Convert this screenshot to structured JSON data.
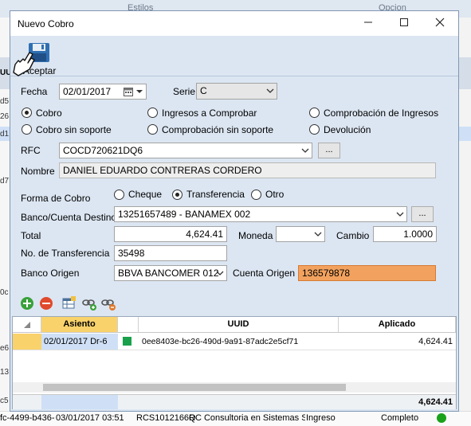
{
  "background": {
    "header_tabs": [
      "Estilos",
      "Opcion"
    ],
    "left_cells": [
      "d5",
      "26",
      "d1",
      "d7",
      "0c",
      "e6",
      "13",
      "c5"
    ],
    "left_header": "UUI",
    "bottom_row": {
      "col1": "fc-4499-b436-",
      "date": "03/01/2017 03:51",
      "rfc": "RCS1012166Q",
      "name": "RC Consultoria en Sistemas SA",
      "type": "Ingreso",
      "status": "Completo"
    }
  },
  "dialog": {
    "title": "Nuevo Cobro",
    "toolbar": {
      "accept_label": "Aceptar"
    },
    "fecha": {
      "label": "Fecha",
      "value": "02/01/2017"
    },
    "serie": {
      "label": "Serie",
      "value": "C"
    },
    "radios": {
      "cobro": "Cobro",
      "cobro_sin_soporte": "Cobro sin soporte",
      "ingresos_a_comprobar": "Ingresos a Comprobar",
      "comprobacion_sin_soporte": "Comprobación sin soporte",
      "comprobacion_de_ingresos": "Comprobación de Ingresos",
      "devolucion": "Devolución"
    },
    "rfc": {
      "label": "RFC",
      "value": "COCD720621DQ6",
      "button": "..."
    },
    "nombre": {
      "label": "Nombre",
      "value": "DANIEL EDUARDO CONTRERAS CORDERO"
    },
    "forma_cobro": {
      "label": "Forma de Cobro",
      "cheque": "Cheque",
      "transferencia": "Transferencia",
      "otro": "Otro"
    },
    "banco_destino": {
      "label": "Banco/Cuenta Destino",
      "value": "13251657489 - BANAMEX  002",
      "button": "..."
    },
    "total": {
      "label": "Total",
      "value": "4,624.41"
    },
    "moneda": {
      "label": "Moneda",
      "value": ""
    },
    "cambio": {
      "label": "Cambio",
      "value": "1.0000"
    },
    "no_transferencia": {
      "label": "No. de Transferencia",
      "value": "35498"
    },
    "banco_origen": {
      "label": "Banco Origen",
      "value": "BBVA BANCOMER  012"
    },
    "cuenta_origen": {
      "label": "Cuenta Origen",
      "value": "136579878"
    },
    "grid": {
      "headers": {
        "asiento": "Asiento",
        "uuid": "UUID",
        "aplicado": "Aplicado"
      },
      "rows": [
        {
          "asiento": "02/01/2017 Dr-6",
          "uuid": "0ee8403e-bc26-490d-9a91-87adc2e5cf71",
          "aplicado": "4,624.41"
        }
      ],
      "total": "4,624.41"
    }
  },
  "colors": {
    "accent_orange": "#f2a25e",
    "grid_header": "#f9d26b",
    "status_green": "#1aa11a"
  }
}
